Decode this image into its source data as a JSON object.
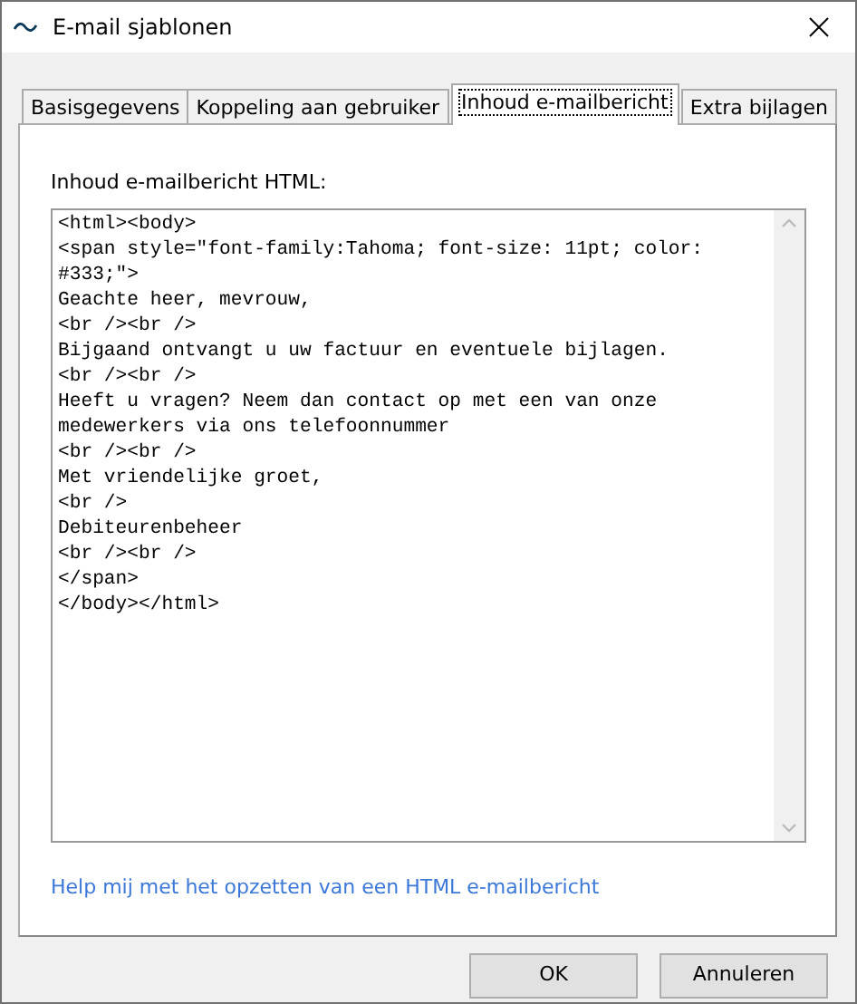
{
  "window": {
    "title": "E-mail sjablonen"
  },
  "tabs": [
    {
      "label": "Basisgegevens",
      "selected": false
    },
    {
      "label": "Koppeling aan gebruiker",
      "selected": false
    },
    {
      "label": "Inhoud e-mailbericht",
      "selected": true
    },
    {
      "label": "Extra bijlagen",
      "selected": false
    }
  ],
  "editor": {
    "label": "Inhoud e-mailbericht HTML:",
    "lines": [
      "<html><body>",
      "<span style=\"font-family:Tahoma; font-size: 11pt; color:",
      "#333;\">",
      "Geachte heer, mevrouw,",
      "<br /><br />",
      "Bijgaand ontvangt u uw factuur en eventuele bijlagen.",
      "<br /><br />",
      "Heeft u vragen? Neem dan contact op met een van onze",
      "medewerkers via ons telefoonnummer",
      "<br /><br />",
      "Met vriendelijke groet,",
      "<br />",
      "Debiteurenbeheer",
      "<br /><br />",
      "</span>",
      "</body></html>"
    ]
  },
  "help_link": "Help mij met het opzetten van een HTML e-mailbericht",
  "buttons": [
    "OK",
    "Annuleren"
  ]
}
